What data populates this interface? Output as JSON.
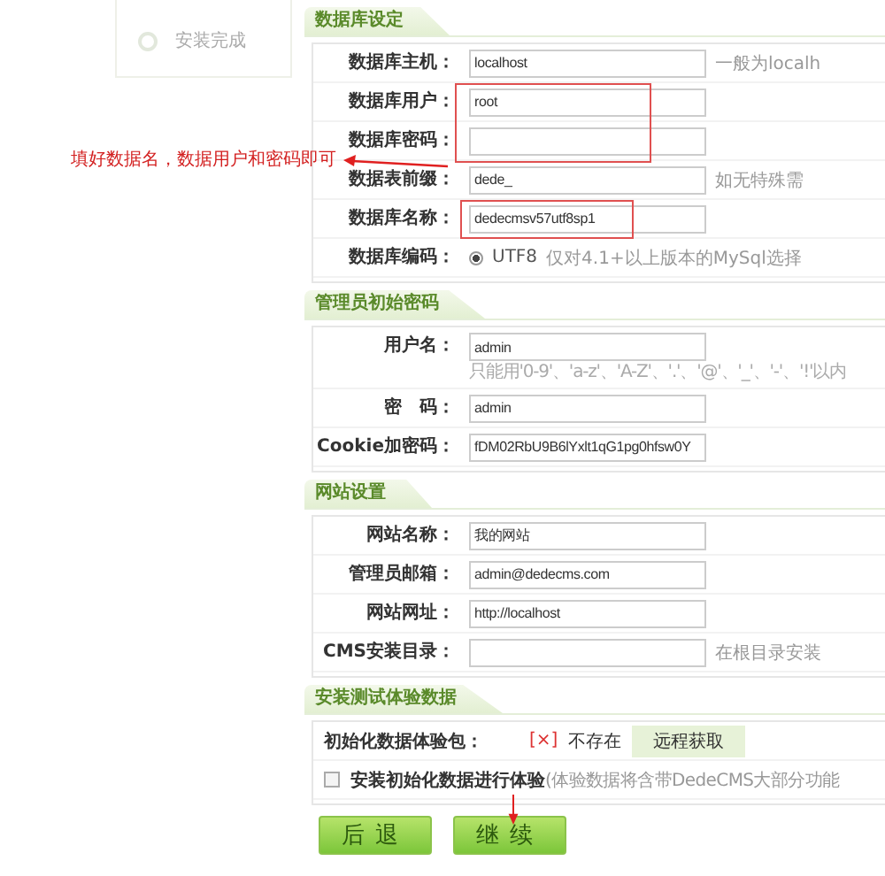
{
  "sidebar": {
    "steps": [
      {
        "label": "安装完成"
      }
    ]
  },
  "sections": [
    {
      "title": "数据库设定",
      "rows": [
        {
          "kind": "input",
          "label": "数据库主机：",
          "value": "localhost",
          "hint": "一般为localh"
        },
        {
          "kind": "input",
          "label": "数据库用户：",
          "value": "root"
        },
        {
          "kind": "input",
          "label": "数据库密码："
        },
        {
          "kind": "input",
          "label": "数据表前缀：",
          "value": "dede_",
          "hint": "如无特殊需"
        },
        {
          "kind": "input",
          "label": "数据库名称：",
          "value": "dedecmsv57utf8sp1"
        },
        {
          "kind": "radio",
          "label": "数据库编码：",
          "option": "UTF8",
          "selected": true,
          "hint": "仅对4.1+以上版本的MySql选择"
        }
      ]
    },
    {
      "title": "管理员初始密码",
      "rows": [
        {
          "kind": "input",
          "label": "用户名：",
          "value": "admin",
          "note": "只能用'0-9'、'a-z'、'A-Z'、'.'、'@'、'_'、'-'、'!'以内"
        },
        {
          "kind": "input",
          "label": "密　码：",
          "value": "admin"
        },
        {
          "kind": "input",
          "label": "Cookie加密码：",
          "value": "fDM02RbU9B6lYxlt1qG1pg0hfsw0Y"
        }
      ]
    },
    {
      "title": "网站设置",
      "rows": [
        {
          "kind": "input",
          "label": "网站名称：",
          "value": "我的网站"
        },
        {
          "kind": "input",
          "label": "管理员邮箱：",
          "value": "admin@dedecms.com"
        },
        {
          "kind": "input",
          "label": "网站网址：",
          "value": "http://localhost"
        },
        {
          "kind": "input",
          "label": "CMS安装目录：",
          "hint": "在根目录安装"
        }
      ]
    },
    {
      "title": "安装测试体验数据",
      "rows": [
        {
          "kind": "status",
          "label": "初始化数据体验包：",
          "mark": "[×]",
          "status": "不存在",
          "button": "远程获取"
        },
        {
          "kind": "checkbox",
          "label": "安装初始化数据进行体验",
          "checked": false,
          "hint": "(体验数据将含带DedeCMS大部分功能"
        }
      ]
    }
  ],
  "annotation": {
    "text": "填好数据名，数据用户和密码即可"
  },
  "buttons": [
    "后退",
    "继续"
  ]
}
